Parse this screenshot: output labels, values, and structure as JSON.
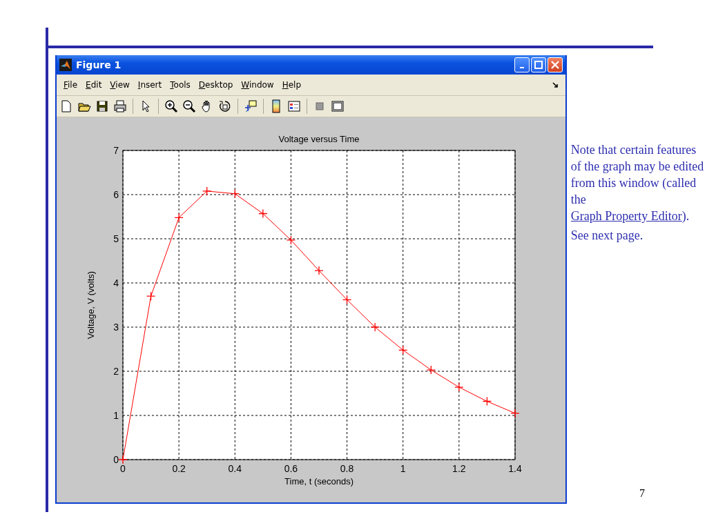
{
  "window": {
    "title": "Figure 1"
  },
  "menu": [
    "File",
    "Edit",
    "View",
    "Insert",
    "Tools",
    "Desktop",
    "Window",
    "Help"
  ],
  "chart_data": {
    "type": "line",
    "title": "Voltage versus Time",
    "xlabel": "Time, t (seconds)",
    "ylabel": "Voltage, V (volts)",
    "x": [
      0,
      0.1,
      0.2,
      0.3,
      0.4,
      0.5,
      0.6,
      0.7,
      0.8,
      0.9,
      1.0,
      1.1,
      1.2,
      1.3,
      1.4
    ],
    "grid": true,
    "series": [
      {
        "color": "#ff0000",
        "marker": "+",
        "values": [
          0,
          3.7,
          5.48,
          6.08,
          6.02,
          5.57,
          4.97,
          4.28,
          3.62,
          3.0,
          2.48,
          2.03,
          1.64,
          1.32,
          1.05
        ]
      }
    ],
    "xlim": [
      0,
      1.4
    ],
    "ylim": [
      0,
      7
    ],
    "xticks": [
      {
        "value": 0,
        "label": "0"
      },
      {
        "value": 0.2,
        "label": "0.2"
      },
      {
        "value": 0.4,
        "label": "0.4"
      },
      {
        "value": 0.6,
        "label": "0.6"
      },
      {
        "value": 0.8,
        "label": "0.8"
      },
      {
        "value": 1,
        "label": "1"
      },
      {
        "value": 1.2,
        "label": "1.2"
      },
      {
        "value": 1.4,
        "label": "1.4"
      }
    ],
    "yticks": [
      {
        "value": 0,
        "label": "0"
      },
      {
        "value": 1,
        "label": "1"
      },
      {
        "value": 2,
        "label": "2"
      },
      {
        "value": 3,
        "label": "3"
      },
      {
        "value": 4,
        "label": "4"
      },
      {
        "value": 5,
        "label": "5"
      },
      {
        "value": 6,
        "label": "6"
      },
      {
        "value": 7,
        "label": "7"
      }
    ]
  },
  "note": {
    "before": "Note that certain features of the graph may be edited from this window (called the ",
    "link": "Graph Property Editor",
    "after": ")."
  },
  "next": "See next page.",
  "page_number": "7"
}
